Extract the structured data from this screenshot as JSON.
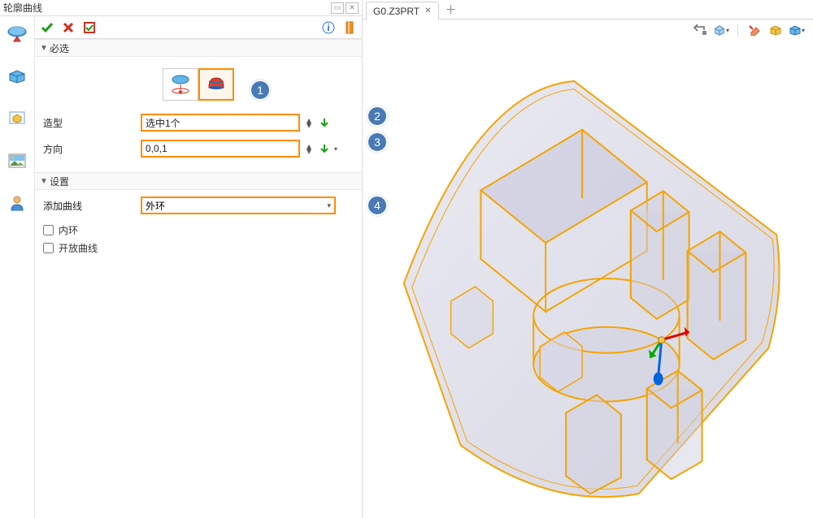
{
  "panel": {
    "title": "轮廓曲线",
    "minimize_hint": "最小化",
    "close_hint": "关闭"
  },
  "toolbar": {
    "ok_label": "确认",
    "cancel_label": "取消",
    "apply_label": "应用",
    "info_label": "信息",
    "help_label": "帮助"
  },
  "section1": {
    "header": "必选",
    "option1_hint": "投影",
    "option2_hint": "轮廓",
    "field_shape_label": "造型",
    "field_shape_value": "选中1个",
    "field_dir_label": "方向",
    "field_dir_value": "0,0,1"
  },
  "section2": {
    "header": "设置",
    "field_addcurve_label": "添加曲线",
    "field_addcurve_value": "外环",
    "check_inner_label": "内环",
    "check_open_label": "开放曲线"
  },
  "annotations": {
    "a1": "1",
    "a2": "2",
    "a3": "3",
    "a4": "4"
  },
  "tab": {
    "label": "G0.Z3PRT",
    "add_hint": "新建"
  },
  "view_icons": {
    "home": "主视图",
    "orient": "方向",
    "erase": "擦除",
    "box": "实体",
    "cube": "立方体"
  }
}
